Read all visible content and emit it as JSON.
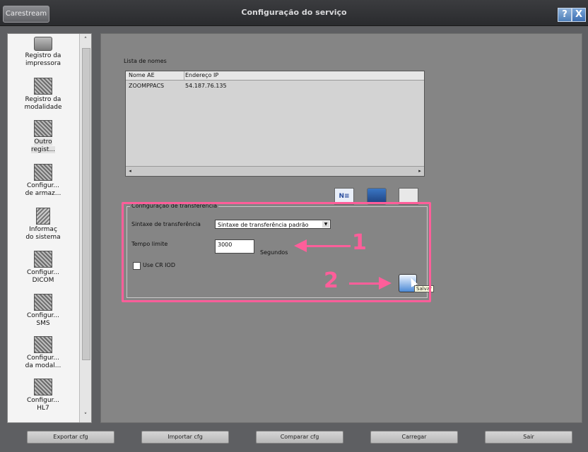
{
  "window": {
    "brand": "Carestream",
    "title": "Configuração do serviço",
    "help": "?",
    "close": "X"
  },
  "sidebar": {
    "items": [
      {
        "label": "Registro da\nimpressora"
      },
      {
        "label": "Registro da\nmodalidade"
      },
      {
        "label": "Outro\nregist..."
      },
      {
        "label": "Configur...\nde armaz..."
      },
      {
        "label": "Informaç\ndo sistema"
      },
      {
        "label": "Configur...\nDICOM"
      },
      {
        "label": "Configur...\nSMS"
      },
      {
        "label": "Configur...\nda modal..."
      },
      {
        "label": "Configur...\nHL7"
      }
    ],
    "scroll_up": "˄",
    "scroll_down": "˅"
  },
  "names_list": {
    "label": "Lista de nomes",
    "columns": [
      "Nome AE",
      "Endereço IP"
    ],
    "rows": [
      {
        "ae": "ZOOMPPACS",
        "ip": "54.187.76.135"
      }
    ],
    "scroll_left": "◂",
    "scroll_right": "▸"
  },
  "transfer": {
    "group_title": "Configuração de transferência",
    "syntax_label": "Sintaxe de transferência",
    "syntax_value": "Sintaxe de transferência padrão",
    "timeout_label": "Tempo limite",
    "timeout_value": "3000",
    "timeout_unit": "Segundos",
    "use_cr_iod": "Use CR IOD",
    "save_tooltip": "Salvar"
  },
  "annotations": {
    "step1": "1",
    "step2": "2",
    "accent": "#ff5e9a"
  },
  "footer": {
    "export": "Exportar cfg",
    "import": "Importar cfg",
    "compare": "Comparar cfg",
    "load": "Carregar",
    "exit": "Sair"
  }
}
